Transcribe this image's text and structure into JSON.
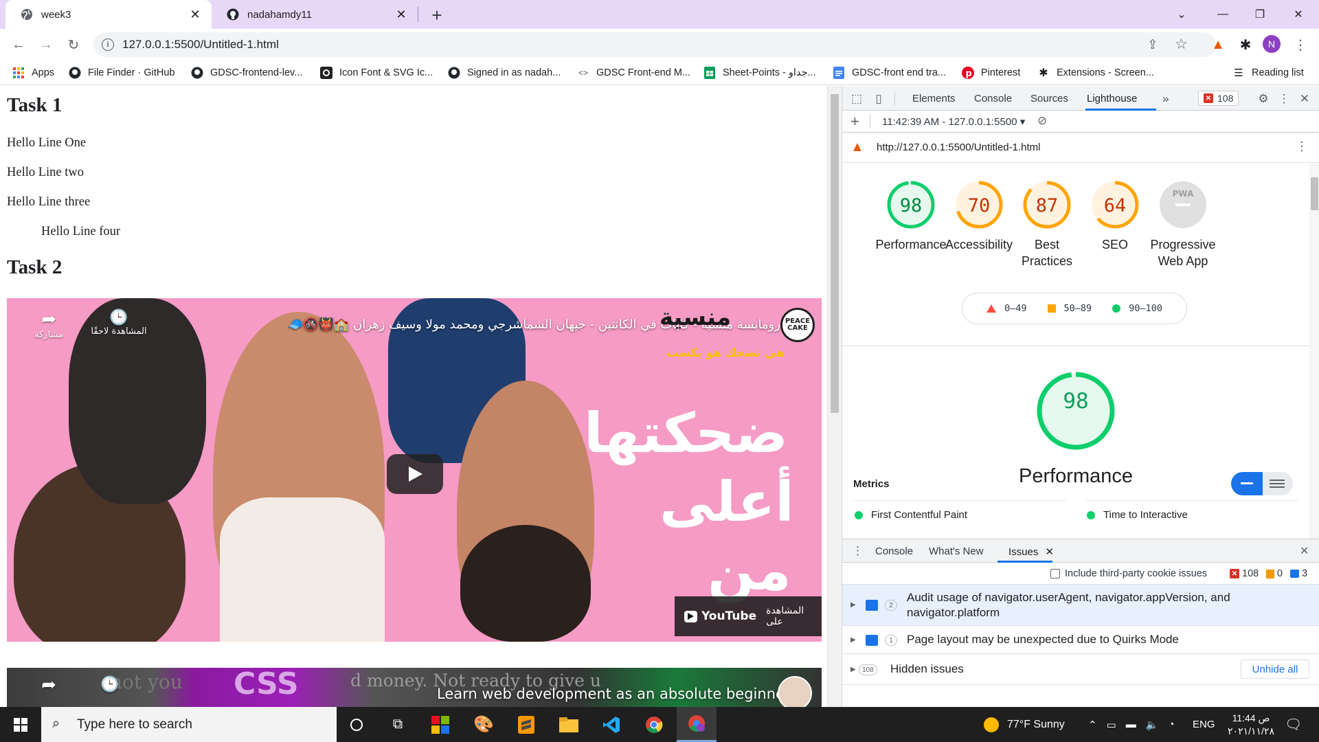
{
  "browser": {
    "tabs": [
      {
        "title": "week3",
        "active": true
      },
      {
        "title": "nadahamdy11",
        "active": false
      }
    ],
    "address": "127.0.0.1:5500/Untitled-1.html",
    "profile_initial": "N",
    "bookmarks": [
      "Apps",
      "File Finder · GitHub",
      "GDSC-frontend-lev...",
      "Icon Font & SVG Ic...",
      "Signed in as nadah...",
      "GDSC Front-end M...",
      "Sheet-Points - جداو...",
      "GDSC-front end tra...",
      "Pinterest",
      "Extensions - Screen..."
    ],
    "reading_list": "Reading list"
  },
  "page": {
    "task1": "Task 1",
    "lines": [
      "Hello Line One",
      "Hello Line two",
      "Hello Line three",
      "Hello Line four"
    ],
    "task2": "Task 2",
    "video1": {
      "title": "رومانسة منسية - كابات في الكانتين - جيهان الشماشرجي ومحمد مولا وسيف زهران 🏫👹🚳🧢",
      "channel_badge": "PEACE CAKE",
      "share": "مشاركة",
      "watch_later": "المشاهدة لاحقًا",
      "watch_on": "المشاهدة على",
      "youtube": "YouTube",
      "overlay_line1": "ضحكتها",
      "overlay_line2": "أعلى",
      "overlay_line3": "من",
      "logo_text": "منسية",
      "logo_sub": "هي تضحك هو يكسب"
    },
    "video2": {
      "title": "Learn web development as an absolute beginner",
      "bg_words": [
        "not you",
        "CSS",
        "d money. Not ready to give u"
      ]
    }
  },
  "devtools": {
    "tabs": [
      "Elements",
      "Console",
      "Sources",
      "Lighthouse"
    ],
    "active_tab": "Lighthouse",
    "error_count": "108",
    "report_selector": "11:42:39 AM - 127.0.0.1:5500",
    "report_url": "http://127.0.0.1:5500/Untitled-1.html",
    "scores": [
      {
        "label": "Performance",
        "value": 98,
        "color": "#0cce6b",
        "text_color": "#008a3e"
      },
      {
        "label": "Accessibility",
        "value": 70,
        "color": "#ffa400",
        "text_color": "#c33300"
      },
      {
        "label": "Best Practices",
        "value": 87,
        "color": "#ffa400",
        "text_color": "#c33300"
      },
      {
        "label": "SEO",
        "value": 64,
        "color": "#ffa400",
        "text_color": "#c33300"
      },
      {
        "label": "Progressive Web App",
        "value": null,
        "badge": "PWA"
      }
    ],
    "legend": [
      {
        "range": "0–49",
        "color": "#ff4e42"
      },
      {
        "range": "50–89",
        "color": "#ffa400"
      },
      {
        "range": "90–100",
        "color": "#0cce6b"
      }
    ],
    "performance_score": "98",
    "performance_label": "Performance",
    "metrics_title": "Metrics",
    "metrics": [
      "First Contentful Paint",
      "Time to Interactive"
    ],
    "drawer": {
      "tabs": [
        "Console",
        "What's New",
        "Issues"
      ],
      "active_tab": "Issues",
      "third_party_label": "Include third-party cookie issues",
      "counts": {
        "errors": "108",
        "warnings": "0",
        "info": "3"
      },
      "issues": [
        {
          "count": "2",
          "text": "Audit usage of navigator.userAgent, navigator.appVersion, and navigator.platform"
        },
        {
          "count": "1",
          "text": "Page layout may be unexpected due to Quirks Mode"
        },
        {
          "count": "108",
          "text": "Hidden issues"
        }
      ],
      "unhide_label": "Unhide all"
    }
  },
  "taskbar": {
    "search_placeholder": "Type here to search",
    "weather": "77°F  Sunny",
    "language": "ENG",
    "time": "11:44 ص",
    "date": "٢٠٢١/١١/٢٨"
  }
}
